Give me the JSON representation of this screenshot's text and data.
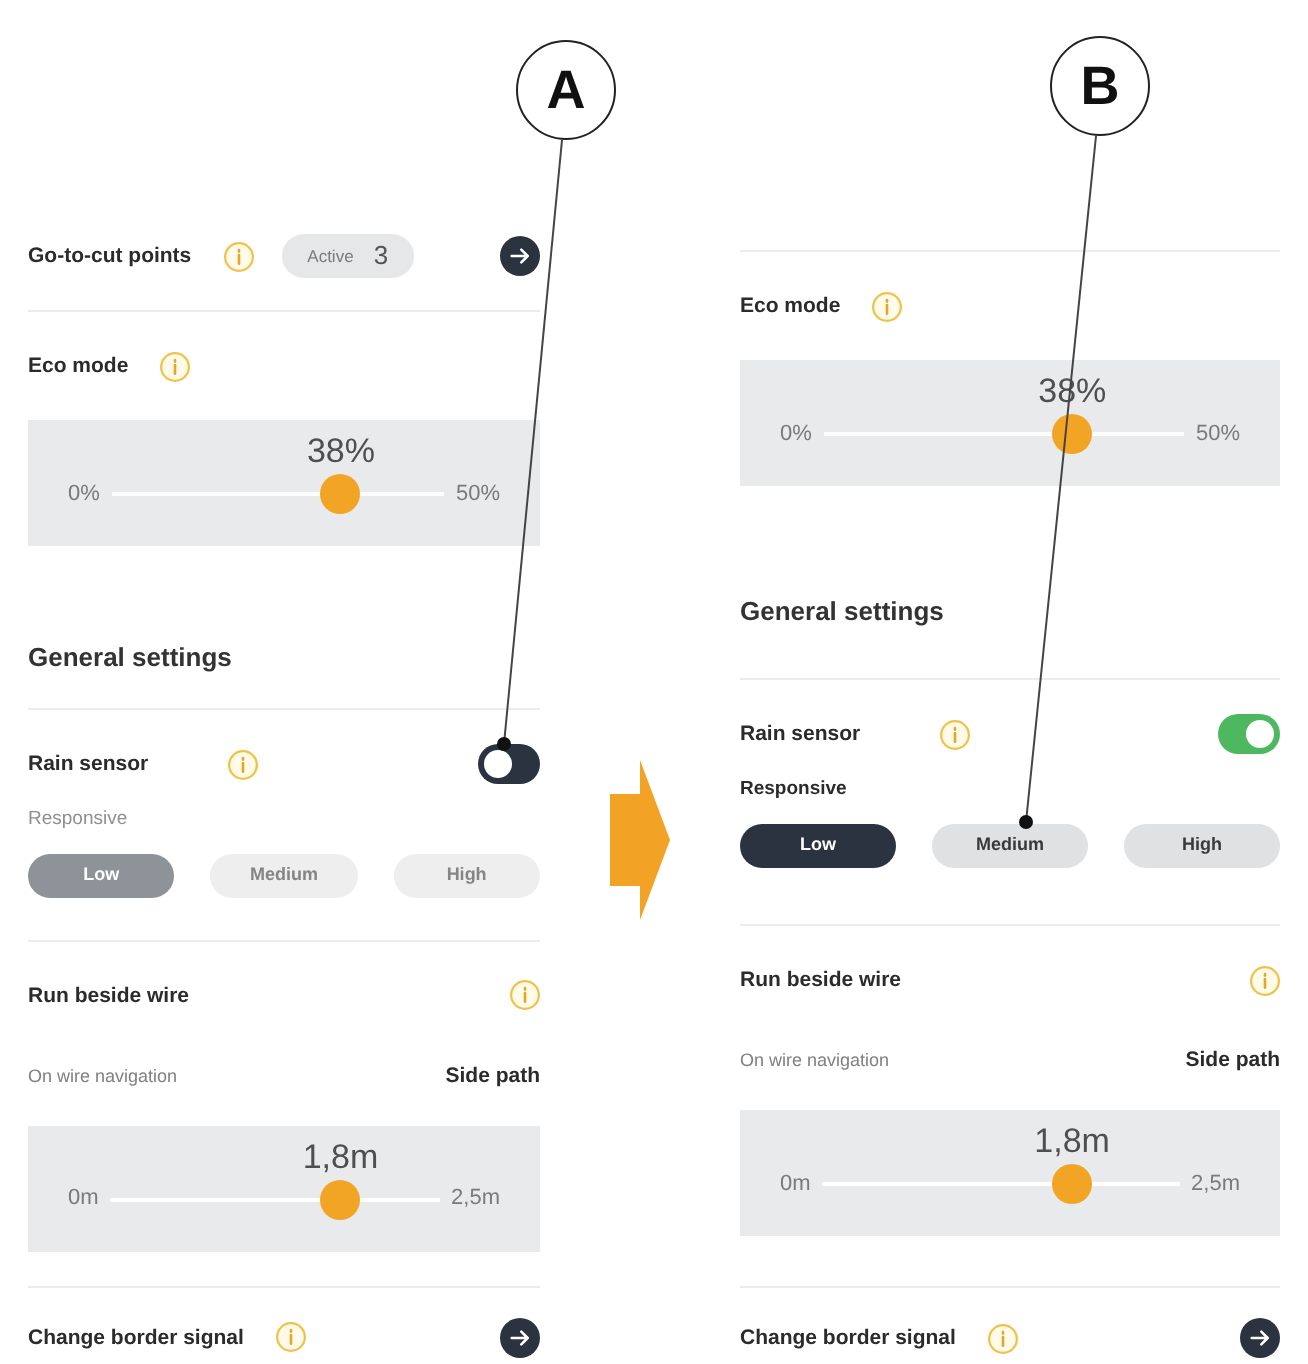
{
  "callouts": [
    {
      "label": "A"
    },
    {
      "label": "B"
    }
  ],
  "panels": [
    {
      "scrolled": false,
      "items": [
        {
          "kind": "nav",
          "label": "Go-to-cut points",
          "badge": {
            "label": "Active",
            "value": "3"
          }
        },
        {
          "kind": "slider",
          "label": "Eco mode",
          "reading": "38%",
          "min": "0%",
          "max": "50%",
          "level": 0.69
        },
        {
          "kind": "heading",
          "label": "General settings"
        },
        {
          "kind": "toggle",
          "label": "Rain sensor",
          "on": false,
          "sub_label": "Responsive",
          "disabled": true,
          "options": [
            {
              "label": "Low",
              "selected": true
            },
            {
              "label": "Medium",
              "selected": false
            },
            {
              "label": "High",
              "selected": false
            }
          ]
        },
        {
          "kind": "wire",
          "label": "Run beside wire",
          "mode_label": "On wire navigation",
          "mode_value": "Side path",
          "reading": "1,8m",
          "min": "0m",
          "max": "2,5m",
          "level": 0.7
        },
        {
          "kind": "nav",
          "label": "Change border signal"
        }
      ]
    },
    {
      "scrolled": true,
      "items": [
        {
          "kind": "slider",
          "label": "Eco mode",
          "reading": "38%",
          "min": "0%",
          "max": "50%",
          "level": 0.69
        },
        {
          "kind": "heading",
          "label": "General settings"
        },
        {
          "kind": "toggle",
          "label": "Rain sensor",
          "on": true,
          "sub_label": "Responsive",
          "disabled": false,
          "options": [
            {
              "label": "Low",
              "selected": true
            },
            {
              "label": "Medium",
              "selected": false
            },
            {
              "label": "High",
              "selected": false
            }
          ]
        },
        {
          "kind": "wire",
          "label": "Run beside wire",
          "mode_label": "On wire navigation",
          "mode_value": "Side path",
          "reading": "1,8m",
          "min": "0m",
          "max": "2,5m",
          "level": 0.7
        },
        {
          "kind": "nav",
          "label": "Change border signal"
        }
      ]
    }
  ]
}
